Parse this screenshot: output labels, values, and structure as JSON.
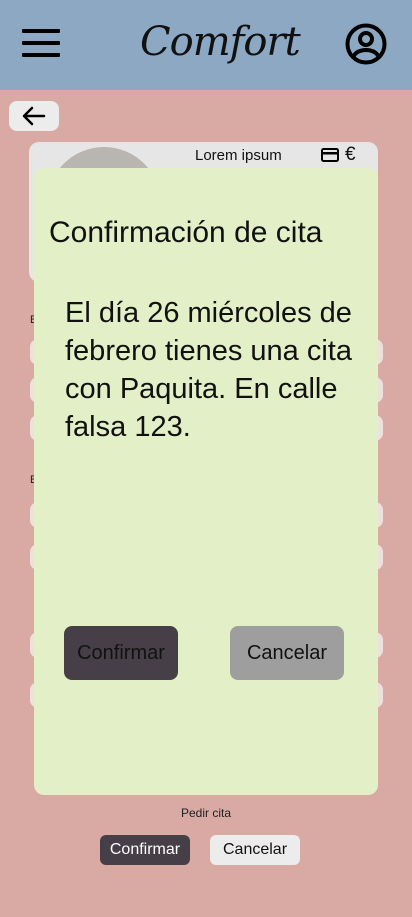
{
  "header": {
    "logo_text": "Comfort",
    "menu_icon": "hamburger-menu-icon",
    "user_icon": "user-circle-icon"
  },
  "nav": {
    "back_icon": "arrow-left-icon"
  },
  "card": {
    "name": "Lorem ipsum",
    "payment_icon": "credit-card-icon",
    "euro_symbol": "€"
  },
  "background": {
    "section_label_1": "E",
    "section_label_2": "E",
    "request_label": "Pedir cita",
    "confirm_label": "Confirmar",
    "cancel_label": "Cancelar"
  },
  "modal": {
    "title": "Confirmación de cita",
    "message": "El día 26 miércoles de febrero tienes una cita con Paquita. En calle falsa 123.",
    "confirm_label": "Confirmar",
    "cancel_label": "Cancelar"
  },
  "colors": {
    "header_bg": "#8da8c2",
    "page_bg": "#d8aaa3",
    "modal_bg": "#e3efc7",
    "confirm_btn": "#473f47",
    "cancel_btn": "#9e9e9e"
  }
}
